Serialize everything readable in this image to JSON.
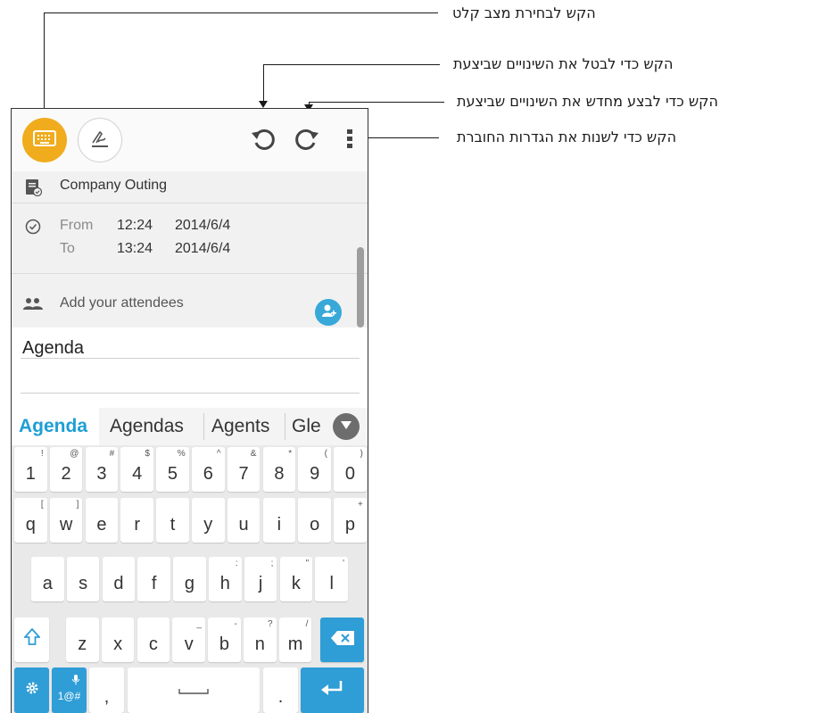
{
  "callouts": {
    "input_mode": "הקש לבחירת מצב קלט",
    "undo": "הקש כדי לבטל את השינויים שביצעת",
    "redo": "הקש כדי לבצע מחדש את השינויים שביצעת",
    "settings": "הקש כדי לשנות את הגדרות החוברת"
  },
  "event": {
    "title": "Company Outing",
    "from_label": "From",
    "from_time": "12:24",
    "from_date": "2014/6/4",
    "to_label": "To",
    "to_time": "13:24",
    "to_date": "2014/6/4",
    "attendees_placeholder": "Add your attendees"
  },
  "editor": {
    "text": "Agenda"
  },
  "suggestions": [
    "Agenda",
    "Agendas",
    "Agents",
    "Gle"
  ],
  "keyboard": {
    "number_row": [
      {
        "main": "1",
        "sub": "!"
      },
      {
        "main": "2",
        "sub": "@"
      },
      {
        "main": "3",
        "sub": "#"
      },
      {
        "main": "4",
        "sub": "$"
      },
      {
        "main": "5",
        "sub": "%"
      },
      {
        "main": "6",
        "sub": "^"
      },
      {
        "main": "7",
        "sub": "&"
      },
      {
        "main": "8",
        "sub": "*"
      },
      {
        "main": "9",
        "sub": "("
      },
      {
        "main": "0",
        "sub": ")"
      }
    ],
    "row1": [
      {
        "main": "q",
        "sub": "["
      },
      {
        "main": "w",
        "sub": "]"
      },
      {
        "main": "e",
        "sub": ""
      },
      {
        "main": "r",
        "sub": ""
      },
      {
        "main": "t",
        "sub": ""
      },
      {
        "main": "y",
        "sub": ""
      },
      {
        "main": "u",
        "sub": ""
      },
      {
        "main": "i",
        "sub": ""
      },
      {
        "main": "o",
        "sub": ""
      },
      {
        "main": "p",
        "sub": "+"
      }
    ],
    "row2": [
      {
        "main": "a",
        "sub": ""
      },
      {
        "main": "s",
        "sub": ""
      },
      {
        "main": "d",
        "sub": ""
      },
      {
        "main": "f",
        "sub": ""
      },
      {
        "main": "g",
        "sub": ""
      },
      {
        "main": "h",
        "sub": ":"
      },
      {
        "main": "j",
        "sub": ";"
      },
      {
        "main": "k",
        "sub": "\""
      },
      {
        "main": "l",
        "sub": "'"
      }
    ],
    "row3": [
      {
        "main": "z",
        "sub": ""
      },
      {
        "main": "x",
        "sub": ""
      },
      {
        "main": "c",
        "sub": ""
      },
      {
        "main": "v",
        "sub": "_"
      },
      {
        "main": "b",
        "sub": "-"
      },
      {
        "main": "n",
        "sub": "?"
      },
      {
        "main": "m",
        "sub": "/"
      }
    ],
    "symbols_label": "1@#",
    "comma": ",",
    "period": "."
  },
  "colors": {
    "accent_orange": "#f0ac1d",
    "accent_blue": "#2f9dd6",
    "suggestion_active": "#1e9fd4"
  },
  "icons": {
    "input_mode": "keyboard-icon",
    "handwriting": "handwriting-icon",
    "undo": "undo-icon",
    "redo": "redo-icon",
    "more": "more-vertical-icon",
    "event": "event-icon",
    "clock": "clock-icon",
    "people": "people-icon",
    "add_person": "add-person-icon",
    "collapse": "chevron-down-icon",
    "shift": "shift-icon",
    "backspace": "backspace-icon",
    "settings": "gear-icon",
    "mic": "mic-icon",
    "enter": "enter-icon"
  }
}
